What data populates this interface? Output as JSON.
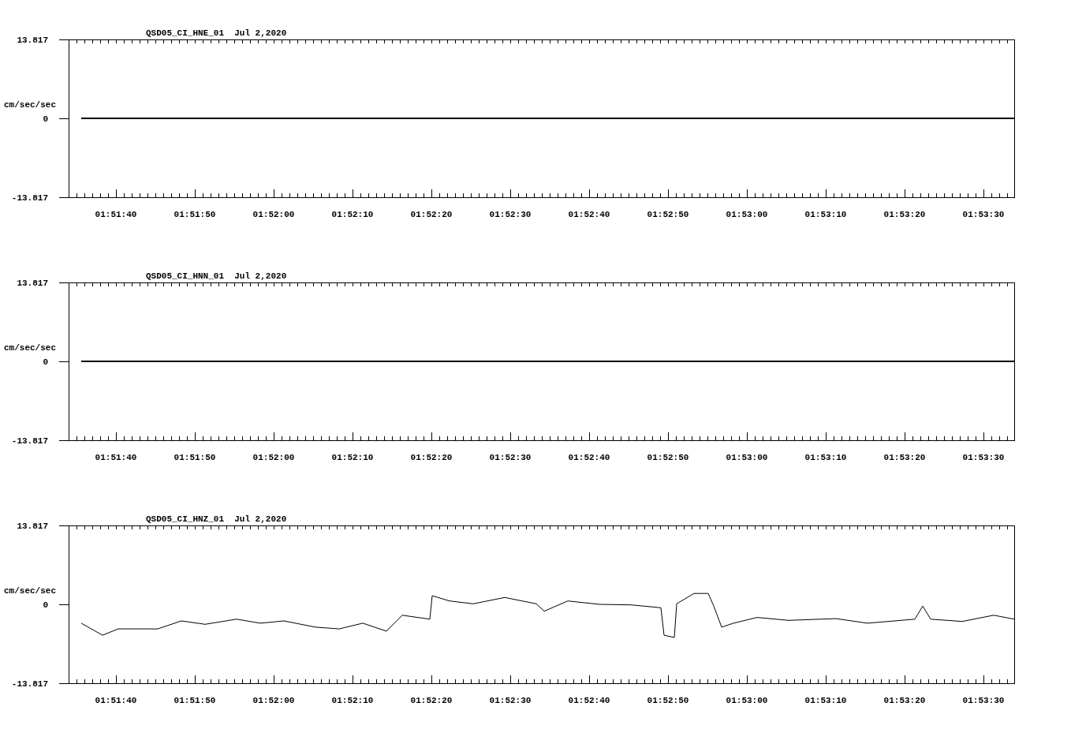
{
  "charts": [
    {
      "chart_data": {
        "type": "line",
        "title": "QSD05_CI_HNE_01  Jul 2,2020",
        "ylabel": "cm/sec/sec",
        "xlim": [
          6694,
          6813.9
        ],
        "ylim": [
          -13.817,
          13.817
        ],
        "yticks": [
          {
            "value": 13.817,
            "label": "13.817"
          },
          {
            "value": 0,
            "label": "0"
          },
          {
            "value": -13.817,
            "label": "-13.817"
          }
        ],
        "xticks": [
          {
            "value": 6700,
            "label": "01:51:40"
          },
          {
            "value": 6710,
            "label": "01:51:50"
          },
          {
            "value": 6720,
            "label": "01:52:00"
          },
          {
            "value": 6730,
            "label": "01:52:10"
          },
          {
            "value": 6740,
            "label": "01:52:20"
          },
          {
            "value": 6750,
            "label": "01:52:30"
          },
          {
            "value": 6760,
            "label": "01:52:40"
          },
          {
            "value": 6770,
            "label": "01:52:50"
          },
          {
            "value": 6780,
            "label": "01:53:00"
          },
          {
            "value": 6790,
            "label": "01:53:10"
          },
          {
            "value": 6800,
            "label": "01:53:20"
          },
          {
            "value": 6810,
            "label": "01:53:30"
          }
        ],
        "x": [
          6695.6,
          6813.9
        ],
        "series": [
          {
            "color": "#000000",
            "values": [
              0,
              0
            ]
          }
        ]
      }
    },
    {
      "chart_data": {
        "type": "line",
        "title": "QSD05_CI_HNN_01  Jul 2,2020",
        "ylabel": "cm/sec/sec",
        "xlim": [
          6694,
          6813.9
        ],
        "ylim": [
          -13.817,
          13.817
        ],
        "yticks": [
          {
            "value": 13.817,
            "label": "13.817"
          },
          {
            "value": 0,
            "label": "0"
          },
          {
            "value": -13.817,
            "label": "-13.817"
          }
        ],
        "xticks": [
          {
            "value": 6700,
            "label": "01:51:40"
          },
          {
            "value": 6710,
            "label": "01:51:50"
          },
          {
            "value": 6720,
            "label": "01:52:00"
          },
          {
            "value": 6730,
            "label": "01:52:10"
          },
          {
            "value": 6740,
            "label": "01:52:20"
          },
          {
            "value": 6750,
            "label": "01:52:30"
          },
          {
            "value": 6760,
            "label": "01:52:40"
          },
          {
            "value": 6770,
            "label": "01:52:50"
          },
          {
            "value": 6780,
            "label": "01:53:00"
          },
          {
            "value": 6790,
            "label": "01:53:10"
          },
          {
            "value": 6800,
            "label": "01:53:20"
          },
          {
            "value": 6810,
            "label": "01:53:30"
          }
        ],
        "x": [
          6695.6,
          6813.9
        ],
        "series": [
          {
            "color": "#000000",
            "values": [
              0,
              0
            ]
          }
        ]
      }
    },
    {
      "chart_data": {
        "type": "line",
        "title": "QSD05_CI_HNZ_01  Jul 2,2020",
        "ylabel": "cm/sec/sec",
        "xlim": [
          6694,
          6813.9
        ],
        "ylim": [
          -13.817,
          13.817
        ],
        "yticks": [
          {
            "value": 13.817,
            "label": "13.817"
          },
          {
            "value": 0,
            "label": "0"
          },
          {
            "value": -13.817,
            "label": "-13.817"
          }
        ],
        "xticks": [
          {
            "value": 6700,
            "label": "01:51:40"
          },
          {
            "value": 6710,
            "label": "01:51:50"
          },
          {
            "value": 6720,
            "label": "01:52:00"
          },
          {
            "value": 6730,
            "label": "01:52:10"
          },
          {
            "value": 6740,
            "label": "01:52:20"
          },
          {
            "value": 6750,
            "label": "01:52:30"
          },
          {
            "value": 6760,
            "label": "01:52:40"
          },
          {
            "value": 6770,
            "label": "01:52:50"
          },
          {
            "value": 6780,
            "label": "01:53:00"
          },
          {
            "value": 6790,
            "label": "01:53:10"
          },
          {
            "value": 6800,
            "label": "01:53:20"
          },
          {
            "value": 6810,
            "label": "01:53:30"
          }
        ],
        "x": [
          6695.6,
          6698.3,
          6700.3,
          6703.3,
          6705.3,
          6708.3,
          6711.3,
          6715.3,
          6718.3,
          6721.3,
          6725.3,
          6728.3,
          6731.3,
          6734.3,
          6736.3,
          6739.8,
          6740.1,
          6742.3,
          6745.3,
          6749.3,
          6753.3,
          6754.3,
          6757.3,
          6761.3,
          6765.3,
          6769.1,
          6769.5,
          6770.8,
          6771.1,
          6773.3,
          6775.1,
          6775.8,
          6776.8,
          6778.3,
          6781.3,
          6785.3,
          6791.3,
          6795.3,
          6801.3,
          6802.3,
          6803.3,
          6807.3,
          6811.3,
          6813.9
        ],
        "series": [
          {
            "color": "#000000",
            "values": [
              -3.3,
              -5.4,
              -4.3,
              -4.3,
              -4.3,
              -2.9,
              -3.5,
              -2.6,
              -3.3,
              -2.9,
              -4.0,
              -4.3,
              -3.3,
              -4.7,
              -1.9,
              -2.6,
              1.5,
              0.6,
              0.1,
              1.2,
              0.1,
              -1.2,
              0.6,
              0,
              -0.1,
              -0.6,
              -5.4,
              -5.8,
              0.1,
              1.9,
              1.9,
              -0.3,
              -4.0,
              -3.3,
              -2.3,
              -2.8,
              -2.5,
              -3.3,
              -2.6,
              -0.3,
              -2.6,
              -3.0,
              -1.9,
              -2.6
            ]
          }
        ]
      }
    }
  ]
}
